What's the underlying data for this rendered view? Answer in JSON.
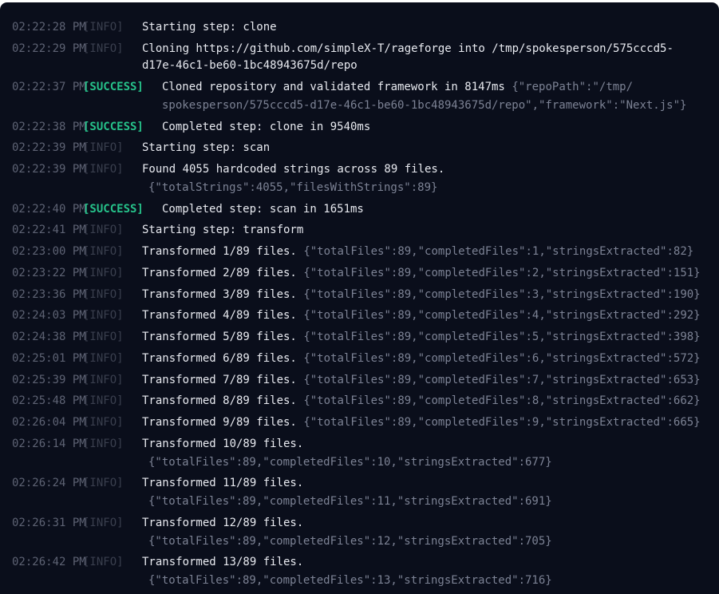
{
  "entries": [
    {
      "time": "02:22:28 PM",
      "level": "[INFO]",
      "message": "Starting step: clone"
    },
    {
      "time": "02:22:29 PM",
      "level": "[INFO]",
      "message": "Cloning https://github.com/simpleX-T/rageforge into /tmp/spokesperson/575cccd5-",
      "continuation": "d17e-46c1-be60-1bc48943675d/repo"
    },
    {
      "time": "02:22:37 PM",
      "level": "[SUCCESS]",
      "message": "Cloned repository and validated framework in 8147ms",
      "meta": "{\"repoPath\":\"/tmp/",
      "meta_continuation": "spokesperson/575cccd5-d17e-46c1-be60-1bc48943675d/repo\",\"framework\":\"Next.js\"}"
    },
    {
      "time": "02:22:38 PM",
      "level": "[SUCCESS]",
      "message": "Completed step: clone in 9540ms"
    },
    {
      "time": "02:22:39 PM",
      "level": "[INFO]",
      "message": "Starting step: scan"
    },
    {
      "time": "02:22:39 PM",
      "level": "[INFO]",
      "message": "Found 4055 hardcoded strings across 89 files.",
      "meta_continuation": "{\"totalStrings\":4055,\"filesWithStrings\":89}"
    },
    {
      "time": "02:22:40 PM",
      "level": "[SUCCESS]",
      "message": "Completed step: scan in 1651ms"
    },
    {
      "time": "02:22:41 PM",
      "level": "[INFO]",
      "message": "Starting step: transform"
    },
    {
      "time": "02:23:00 PM",
      "level": "[INFO]",
      "message": "Transformed 1/89 files.",
      "meta": "{\"totalFiles\":89,\"completedFiles\":1,\"stringsExtracted\":82}"
    },
    {
      "time": "02:23:22 PM",
      "level": "[INFO]",
      "message": "Transformed 2/89 files.",
      "meta": "{\"totalFiles\":89,\"completedFiles\":2,\"stringsExtracted\":151}"
    },
    {
      "time": "02:23:36 PM",
      "level": "[INFO]",
      "message": "Transformed 3/89 files.",
      "meta": "{\"totalFiles\":89,\"completedFiles\":3,\"stringsExtracted\":190}"
    },
    {
      "time": "02:24:03 PM",
      "level": "[INFO]",
      "message": "Transformed 4/89 files.",
      "meta": "{\"totalFiles\":89,\"completedFiles\":4,\"stringsExtracted\":292}"
    },
    {
      "time": "02:24:38 PM",
      "level": "[INFO]",
      "message": "Transformed 5/89 files.",
      "meta": "{\"totalFiles\":89,\"completedFiles\":5,\"stringsExtracted\":398}"
    },
    {
      "time": "02:25:01 PM",
      "level": "[INFO]",
      "message": "Transformed 6/89 files.",
      "meta": "{\"totalFiles\":89,\"completedFiles\":6,\"stringsExtracted\":572}"
    },
    {
      "time": "02:25:39 PM",
      "level": "[INFO]",
      "message": "Transformed 7/89 files.",
      "meta": "{\"totalFiles\":89,\"completedFiles\":7,\"stringsExtracted\":653}"
    },
    {
      "time": "02:25:48 PM",
      "level": "[INFO]",
      "message": "Transformed 8/89 files.",
      "meta": "{\"totalFiles\":89,\"completedFiles\":8,\"stringsExtracted\":662}"
    },
    {
      "time": "02:26:04 PM",
      "level": "[INFO]",
      "message": "Transformed 9/89 files.",
      "meta": "{\"totalFiles\":89,\"completedFiles\":9,\"stringsExtracted\":665}"
    },
    {
      "time": "02:26:14 PM",
      "level": "[INFO]",
      "message": "Transformed 10/89 files.",
      "meta_continuation": "{\"totalFiles\":89,\"completedFiles\":10,\"stringsExtracted\":677}"
    },
    {
      "time": "02:26:24 PM",
      "level": "[INFO]",
      "message": "Transformed 11/89 files.",
      "meta_continuation": "{\"totalFiles\":89,\"completedFiles\":11,\"stringsExtracted\":691}"
    },
    {
      "time": "02:26:31 PM",
      "level": "[INFO]",
      "message": "Transformed 12/89 files.",
      "meta_continuation": "{\"totalFiles\":89,\"completedFiles\":12,\"stringsExtracted\":705}"
    },
    {
      "time": "02:26:42 PM",
      "level": "[INFO]",
      "message": "Transformed 13/89 files.",
      "meta_continuation": "{\"totalFiles\":89,\"completedFiles\":13,\"stringsExtracted\":716}"
    }
  ],
  "colors": {
    "background": "#0a0e1b",
    "timestamp": "#5d6273",
    "info": "#3a3f4e",
    "success": "#26c28a",
    "message": "#e8eaf0",
    "meta": "#7c8294"
  }
}
